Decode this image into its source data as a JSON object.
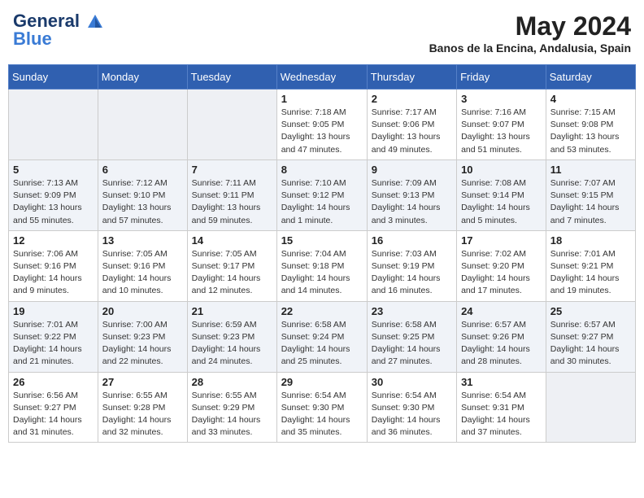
{
  "header": {
    "logo_line1": "General",
    "logo_line2": "Blue",
    "month_year": "May 2024",
    "location": "Banos de la Encina, Andalusia, Spain"
  },
  "weekdays": [
    "Sunday",
    "Monday",
    "Tuesday",
    "Wednesday",
    "Thursday",
    "Friday",
    "Saturday"
  ],
  "weeks": [
    [
      {
        "day": "",
        "info": ""
      },
      {
        "day": "",
        "info": ""
      },
      {
        "day": "",
        "info": ""
      },
      {
        "day": "1",
        "info": "Sunrise: 7:18 AM\nSunset: 9:05 PM\nDaylight: 13 hours and 47 minutes."
      },
      {
        "day": "2",
        "info": "Sunrise: 7:17 AM\nSunset: 9:06 PM\nDaylight: 13 hours and 49 minutes."
      },
      {
        "day": "3",
        "info": "Sunrise: 7:16 AM\nSunset: 9:07 PM\nDaylight: 13 hours and 51 minutes."
      },
      {
        "day": "4",
        "info": "Sunrise: 7:15 AM\nSunset: 9:08 PM\nDaylight: 13 hours and 53 minutes."
      }
    ],
    [
      {
        "day": "5",
        "info": "Sunrise: 7:13 AM\nSunset: 9:09 PM\nDaylight: 13 hours and 55 minutes."
      },
      {
        "day": "6",
        "info": "Sunrise: 7:12 AM\nSunset: 9:10 PM\nDaylight: 13 hours and 57 minutes."
      },
      {
        "day": "7",
        "info": "Sunrise: 7:11 AM\nSunset: 9:11 PM\nDaylight: 13 hours and 59 minutes."
      },
      {
        "day": "8",
        "info": "Sunrise: 7:10 AM\nSunset: 9:12 PM\nDaylight: 14 hours and 1 minute."
      },
      {
        "day": "9",
        "info": "Sunrise: 7:09 AM\nSunset: 9:13 PM\nDaylight: 14 hours and 3 minutes."
      },
      {
        "day": "10",
        "info": "Sunrise: 7:08 AM\nSunset: 9:14 PM\nDaylight: 14 hours and 5 minutes."
      },
      {
        "day": "11",
        "info": "Sunrise: 7:07 AM\nSunset: 9:15 PM\nDaylight: 14 hours and 7 minutes."
      }
    ],
    [
      {
        "day": "12",
        "info": "Sunrise: 7:06 AM\nSunset: 9:16 PM\nDaylight: 14 hours and 9 minutes."
      },
      {
        "day": "13",
        "info": "Sunrise: 7:05 AM\nSunset: 9:16 PM\nDaylight: 14 hours and 10 minutes."
      },
      {
        "day": "14",
        "info": "Sunrise: 7:05 AM\nSunset: 9:17 PM\nDaylight: 14 hours and 12 minutes."
      },
      {
        "day": "15",
        "info": "Sunrise: 7:04 AM\nSunset: 9:18 PM\nDaylight: 14 hours and 14 minutes."
      },
      {
        "day": "16",
        "info": "Sunrise: 7:03 AM\nSunset: 9:19 PM\nDaylight: 14 hours and 16 minutes."
      },
      {
        "day": "17",
        "info": "Sunrise: 7:02 AM\nSunset: 9:20 PM\nDaylight: 14 hours and 17 minutes."
      },
      {
        "day": "18",
        "info": "Sunrise: 7:01 AM\nSunset: 9:21 PM\nDaylight: 14 hours and 19 minutes."
      }
    ],
    [
      {
        "day": "19",
        "info": "Sunrise: 7:01 AM\nSunset: 9:22 PM\nDaylight: 14 hours and 21 minutes."
      },
      {
        "day": "20",
        "info": "Sunrise: 7:00 AM\nSunset: 9:23 PM\nDaylight: 14 hours and 22 minutes."
      },
      {
        "day": "21",
        "info": "Sunrise: 6:59 AM\nSunset: 9:23 PM\nDaylight: 14 hours and 24 minutes."
      },
      {
        "day": "22",
        "info": "Sunrise: 6:58 AM\nSunset: 9:24 PM\nDaylight: 14 hours and 25 minutes."
      },
      {
        "day": "23",
        "info": "Sunrise: 6:58 AM\nSunset: 9:25 PM\nDaylight: 14 hours and 27 minutes."
      },
      {
        "day": "24",
        "info": "Sunrise: 6:57 AM\nSunset: 9:26 PM\nDaylight: 14 hours and 28 minutes."
      },
      {
        "day": "25",
        "info": "Sunrise: 6:57 AM\nSunset: 9:27 PM\nDaylight: 14 hours and 30 minutes."
      }
    ],
    [
      {
        "day": "26",
        "info": "Sunrise: 6:56 AM\nSunset: 9:27 PM\nDaylight: 14 hours and 31 minutes."
      },
      {
        "day": "27",
        "info": "Sunrise: 6:55 AM\nSunset: 9:28 PM\nDaylight: 14 hours and 32 minutes."
      },
      {
        "day": "28",
        "info": "Sunrise: 6:55 AM\nSunset: 9:29 PM\nDaylight: 14 hours and 33 minutes."
      },
      {
        "day": "29",
        "info": "Sunrise: 6:54 AM\nSunset: 9:30 PM\nDaylight: 14 hours and 35 minutes."
      },
      {
        "day": "30",
        "info": "Sunrise: 6:54 AM\nSunset: 9:30 PM\nDaylight: 14 hours and 36 minutes."
      },
      {
        "day": "31",
        "info": "Sunrise: 6:54 AM\nSunset: 9:31 PM\nDaylight: 14 hours and 37 minutes."
      },
      {
        "day": "",
        "info": ""
      }
    ]
  ]
}
